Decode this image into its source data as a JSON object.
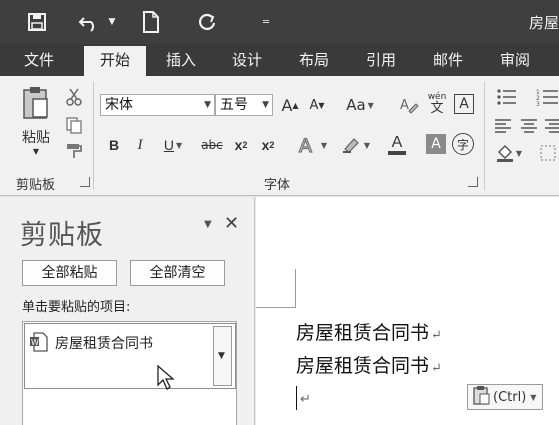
{
  "window": {
    "title": "房屋"
  },
  "quick_access": {
    "save_icon": "save-icon",
    "undo_icon": "undo-icon",
    "new_doc_icon": "new-document-icon",
    "redo_icon": "redo-icon",
    "customize_icon": "customize-qat-icon"
  },
  "tabs": [
    {
      "label": "文件",
      "active": false
    },
    {
      "label": "开始",
      "active": true
    },
    {
      "label": "插入",
      "active": false
    },
    {
      "label": "设计",
      "active": false
    },
    {
      "label": "布局",
      "active": false
    },
    {
      "label": "引用",
      "active": false
    },
    {
      "label": "邮件",
      "active": false
    },
    {
      "label": "审阅",
      "active": false
    }
  ],
  "ribbon": {
    "clipboard_group": {
      "label": "剪贴板",
      "paste_label": "粘贴"
    },
    "font_group": {
      "label": "字体",
      "font_name": "宋体",
      "font_size": "五号",
      "grow_font": "A",
      "shrink_font": "A",
      "change_case": "Aa",
      "pinyin_top": "wén",
      "pinyin_bottom": "文",
      "char_border": "A",
      "bold": "B",
      "italic": "I",
      "underline": "U",
      "strikethrough": "abc",
      "subscript": "x",
      "subscript_sub": "2",
      "superscript": "x",
      "superscript_sup": "2",
      "font_color": "A",
      "char_shading": "A",
      "enclose_char": "字"
    }
  },
  "clipboard_pane": {
    "title": "剪贴板",
    "paste_all_label": "全部粘贴",
    "clear_all_label": "全部清空",
    "instruction": "单击要粘贴的项目:",
    "items": [
      {
        "text": "房屋租赁合同书"
      }
    ]
  },
  "document": {
    "lines": [
      "房屋租赁合同书",
      "房屋租赁合同书"
    ],
    "paragraph_mark": "↵",
    "paste_options_label": "(Ctrl)"
  },
  "colors": {
    "title_bar": "#3f3f3f",
    "tab_bar": "#3a3a3a",
    "ribbon": "#f1f1f1",
    "pane": "#f0f0f0"
  }
}
